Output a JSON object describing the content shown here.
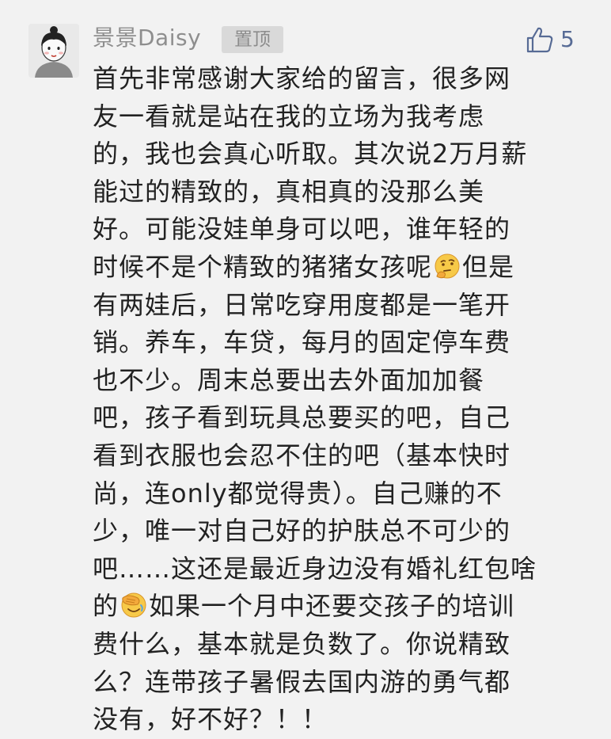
{
  "comment": {
    "username": "景景Daisy",
    "pinned_badge": "置顶",
    "like_count": "5",
    "like_icon": "thumbs-up-outline-icon",
    "accent_color": "#576b95",
    "lines": [
      {
        "text": "首先非常感谢大家给的留言，很多网"
      },
      {
        "text": "友一看就是站在我的立场为我考虑"
      },
      {
        "text": "的，我也会真心听取。其次说2万月薪"
      },
      {
        "text": "能过的精致的，真相真的没那么美"
      },
      {
        "text": "好。可能没娃单身可以吧，谁年轻的"
      },
      {
        "pre": "时候不是个精致的猪猪女孩呢",
        "emoji": "thinking-face-emoji",
        "post": "但是"
      },
      {
        "text": "有两娃后，日常吃穿用度都是一笔开"
      },
      {
        "text": "销。养车，车贷，每月的固定停车费"
      },
      {
        "text": "也不少。周末总要出去外面加加餐"
      },
      {
        "text": "吧，孩子看到玩具总要买的吧，自己"
      },
      {
        "text": "看到衣服也会忍不住的吧（基本快时"
      },
      {
        "text": "尚，连only都觉得贵）。自己赚的不"
      },
      {
        "text": "少，唯一对自己好的护肤总不可少的"
      },
      {
        "text": "吧……这还是最近身边没有婚礼红包啥"
      },
      {
        "pre": "的",
        "emoji": "face-palm-emoji",
        "post": "如果一个月中还要交孩子的培训"
      },
      {
        "text": "费什么，基本就是负数了。你说精致"
      },
      {
        "text": "么？连带孩子暑假去国内游的勇气都"
      },
      {
        "text": "没有，好不好？！！"
      }
    ]
  }
}
